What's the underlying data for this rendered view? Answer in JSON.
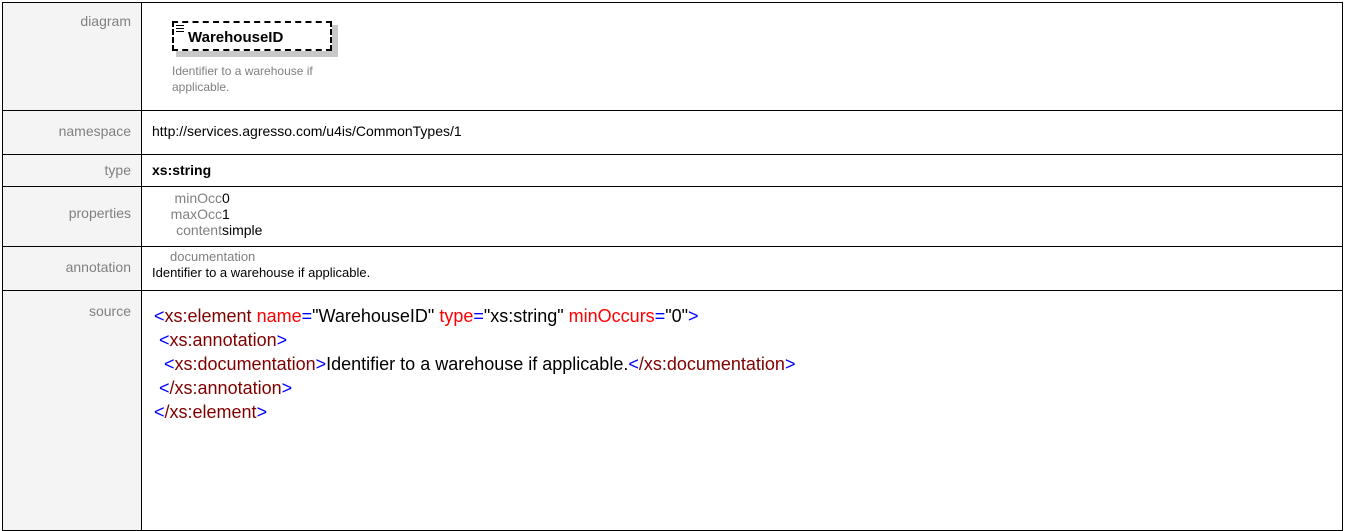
{
  "rows": {
    "diagram": {
      "label": "diagram",
      "element_name": "WarehouseID",
      "description_line1": "Identifier to a warehouse if",
      "description_line2": "applicable."
    },
    "namespace": {
      "label": "namespace",
      "value": "http://services.agresso.com/u4is/CommonTypes/1"
    },
    "type": {
      "label": "type",
      "value": "xs:string"
    },
    "properties": {
      "label": "properties",
      "items": [
        {
          "key": "minOcc",
          "value": "0"
        },
        {
          "key": "maxOcc",
          "value": "1"
        },
        {
          "key": "content",
          "value": "simple"
        }
      ]
    },
    "annotation": {
      "label": "annotation",
      "title": "documentation",
      "text": "Identifier to a warehouse if applicable."
    },
    "source": {
      "label": "source",
      "lines": {
        "l1_tag": "xs:element",
        "l1_attr1": "name",
        "l1_val1": "\"WarehouseID\"",
        "l1_attr2": "type",
        "l1_val2": "\"xs:string\"",
        "l1_attr3": "minOccurs",
        "l1_val3": "\"0\"",
        "l2_tag": "xs:annotation",
        "l3_tag": "xs:documentation",
        "l3_text": "Identifier to a warehouse if applicable.",
        "l3_close": "/xs:documentation",
        "l4_close": "/xs:annotation",
        "l5_close": "/xs:element"
      }
    }
  }
}
